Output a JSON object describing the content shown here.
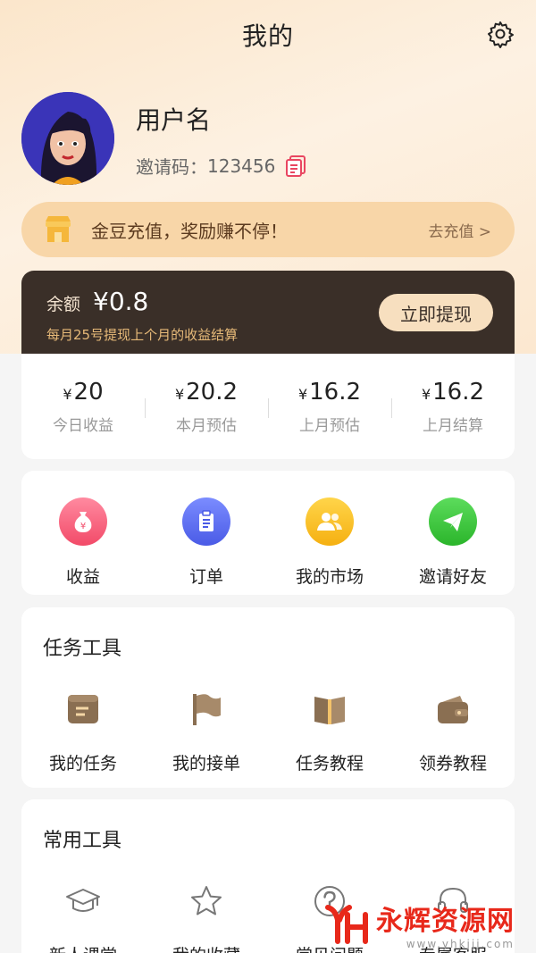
{
  "header": {
    "title": "我的"
  },
  "profile": {
    "username": "用户名",
    "invite_label": "邀请码：",
    "invite_code": "123456"
  },
  "recharge": {
    "text": "金豆充值，奖励赚不停！",
    "link": "去充值 >"
  },
  "balance": {
    "label": "余额",
    "value": "¥0.8",
    "note": "每月25号提现上个月的收益结算",
    "withdraw_label": "立即提现"
  },
  "stats": [
    {
      "currency": "¥",
      "value": "20",
      "label": "今日收益"
    },
    {
      "currency": "¥",
      "value": "20.2",
      "label": "本月预估"
    },
    {
      "currency": "¥",
      "value": "16.2",
      "label": "上月预估"
    },
    {
      "currency": "¥",
      "value": "16.2",
      "label": "上月结算"
    }
  ],
  "quick": [
    {
      "label": "收益",
      "icon": "money-bag-icon",
      "color": "#f7607a"
    },
    {
      "label": "订单",
      "icon": "clipboard-icon",
      "color": "#5b6cf0"
    },
    {
      "label": "我的市场",
      "icon": "users-icon",
      "color": "#f7bf1c"
    },
    {
      "label": "邀请好友",
      "icon": "paper-plane-icon",
      "color": "#3fca3f"
    }
  ],
  "task_tools": {
    "title": "任务工具",
    "items": [
      {
        "label": "我的任务",
        "icon": "task-icon"
      },
      {
        "label": "我的接单",
        "icon": "flag-icon"
      },
      {
        "label": "任务教程",
        "icon": "book-icon"
      },
      {
        "label": "领券教程",
        "icon": "wallet-icon"
      }
    ]
  },
  "common_tools": {
    "title": "常用工具",
    "items": [
      {
        "label": "新人课堂",
        "icon": "graduation-cap-icon"
      },
      {
        "label": "我的收藏",
        "icon": "star-icon"
      },
      {
        "label": "常见问题",
        "icon": "question-icon"
      },
      {
        "label": "专属客服",
        "icon": "headset-icon"
      }
    ]
  },
  "watermark": {
    "title": "永辉资源网",
    "url": "www.yhkjjj.com"
  },
  "colors": {
    "accent": "#3a2f28",
    "gold": "#e6b978",
    "banner": "#f8d6a8"
  }
}
